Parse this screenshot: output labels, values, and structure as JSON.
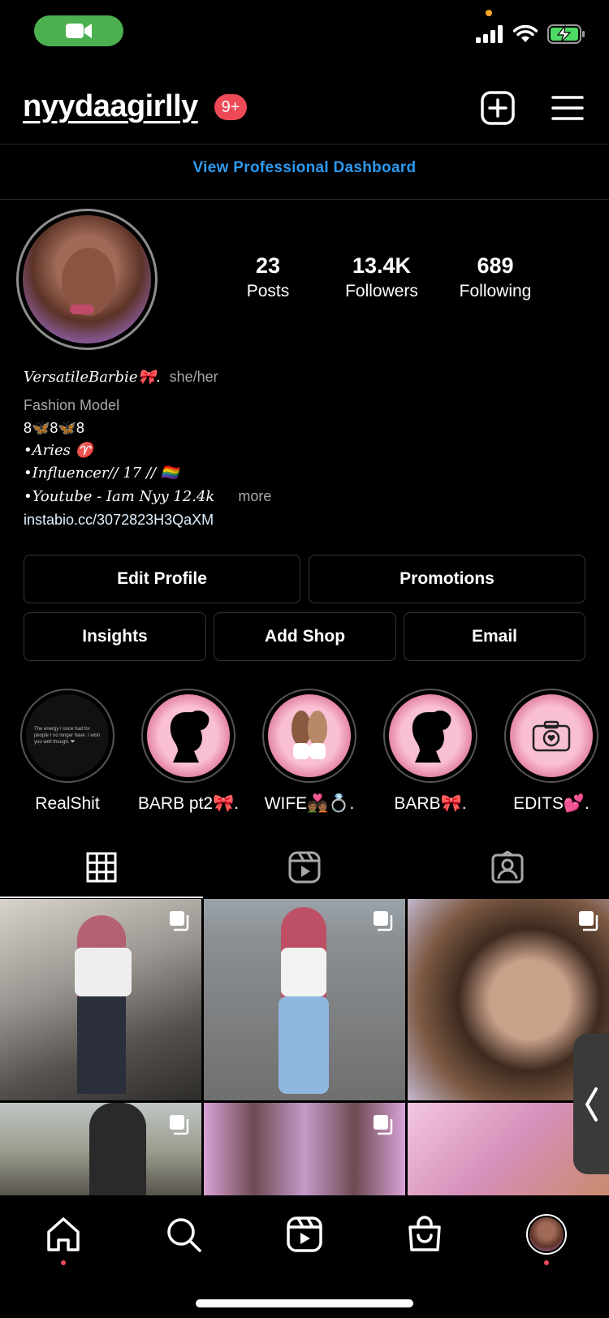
{
  "header": {
    "username": "nyydaagirlly",
    "notification_badge": "9+"
  },
  "dashboard_link": "View Professional Dashboard",
  "stats": [
    {
      "value": "23",
      "label": "Posts"
    },
    {
      "value": "13.4K",
      "label": "Followers"
    },
    {
      "value": "689",
      "label": "Following"
    }
  ],
  "bio": {
    "name": "VersatileBarbie🎀.",
    "pronouns": "she/her",
    "category": "Fashion Model",
    "line1": "8🦋8🦋8",
    "line2": "•Aries ♈",
    "line3": "•Influencer// 17 // 🏳️‍🌈",
    "line4": "•Youtube - Iam Nyy 12.4k",
    "more": "more",
    "link": "instabio.cc/3072823H3QaXM"
  },
  "buttons": {
    "edit_profile": "Edit Profile",
    "promotions": "Promotions",
    "insights": "Insights",
    "add_shop": "Add Shop",
    "email": "Email"
  },
  "highlights": [
    {
      "label": "RealShit",
      "preview_text": "The energy I once had for people I no longer have. I wish you well though. ❤"
    },
    {
      "label": "BARB pt2🎀."
    },
    {
      "label": "WIFE💑🏾💍."
    },
    {
      "label": "BARB🎀."
    },
    {
      "label": "EDITS💕."
    }
  ],
  "tabs": [
    "grid-tab",
    "reels-tab",
    "tagged-tab"
  ],
  "colors": {
    "accent_blue": "#2e9af0",
    "badge_red": "#ed4956",
    "call_green": "#4caf50"
  }
}
